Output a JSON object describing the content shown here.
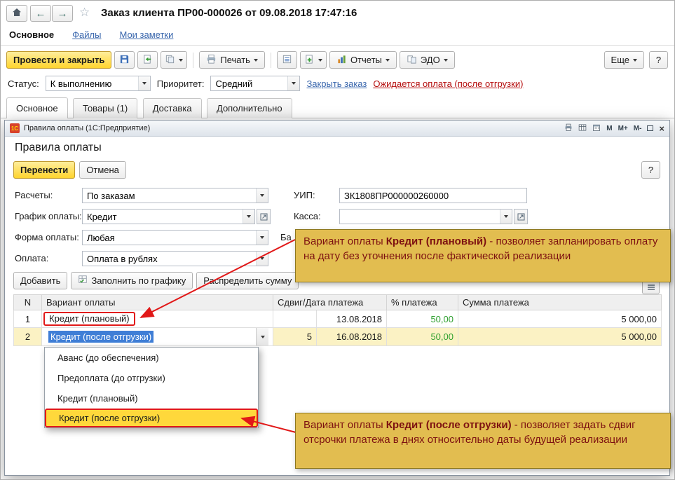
{
  "header": {
    "title": "Заказ клиента ПР00-000026 от 09.08.2018 17:47:16",
    "nav": {
      "main": "Основное",
      "files": "Файлы",
      "notes": "Мои заметки"
    }
  },
  "icons": {
    "star": "☆",
    "back": "←",
    "forward": "→",
    "close": "×"
  },
  "toolbar": {
    "post_and_close": "Провести и закрыть",
    "print": "Печать",
    "reports": "Отчеты",
    "edo": "ЭДО",
    "more": "Еще",
    "help": "?"
  },
  "status_bar": {
    "status_label": "Статус:",
    "status_value": "К выполнению",
    "priority_label": "Приоритет:",
    "priority_value": "Средний",
    "close_order": "Закрыть заказ",
    "payment_note": "Ожидается оплата (после отгрузки)"
  },
  "tabs": {
    "t0": "Основное",
    "t1": "Товары (1)",
    "t2": "Доставка",
    "t3": "Дополнительно"
  },
  "dialog": {
    "titlebar_text": "Правила оплаты  (1С:Предприятие)",
    "mem": {
      "m": "М",
      "mp": "М+",
      "mm": "М-"
    },
    "heading": "Правила оплаты",
    "btn_transfer": "Перенести",
    "btn_cancel": "Отмена",
    "btn_help": "?",
    "form": {
      "calc_label": "Расчеты:",
      "calc_value": "По заказам",
      "uip_label": "УИП:",
      "uip_value": "ЗК1808ПР000000260000",
      "schedule_label": "График оплаты:",
      "schedule_value": "Кредит",
      "cash_label": "Касса:",
      "cash_value": "",
      "payform_label": "Форма оплаты:",
      "payform_value": "Любая",
      "bank_label_partial": "Ба",
      "payment_label": "Оплата:",
      "payment_value": "Оплата в рублях"
    },
    "commands": {
      "add": "Добавить",
      "fill": "Заполнить по графику",
      "distribute": "Распределить сумму"
    },
    "table": {
      "h_n": "N",
      "h_variant": "Вариант оплаты",
      "h_shift_date": "Сдвиг/Дата платежа",
      "h_percent": "% платежа",
      "h_sum": "Сумма платежа",
      "rows": [
        {
          "n": "1",
          "variant": "Кредит (плановый)",
          "shift": "",
          "date": "13.08.2018",
          "percent": "50,00",
          "sum": "5 000,00"
        },
        {
          "n": "2",
          "variant": "Кредит (после отгрузки)",
          "shift": "5",
          "date": "16.08.2018",
          "percent": "50,00",
          "sum": "5 000,00"
        }
      ]
    },
    "dropdown": {
      "i0": "Аванс (до обеспечения)",
      "i1": "Предоплата (до отгрузки)",
      "i2": "Кредит (плановый)",
      "i3": "Кредит (после отгрузки)"
    }
  },
  "callouts": {
    "planned": {
      "prefix": "Вариант оплаты ",
      "bold": "Кредит (плановый)",
      "rest": " - позволяет запланировать оплату на дату без уточнения после фактической реализации"
    },
    "after": {
      "prefix": "Вариант оплаты ",
      "bold": "Кредит (после отгрузки)",
      "rest": " - позволяет задать сдвиг отсрочки платежа в днях относительно даты будущей реализации"
    }
  },
  "colors": {
    "accent_yellow": "#FFD42E",
    "link_blue": "#3A67AD",
    "alert_red": "#B50D0D",
    "percent_green": "#2FA02F",
    "callout_bg": "#E2BD50",
    "selection_blue": "#3F7ED6",
    "highlight_yellow": "#FFD83B"
  }
}
